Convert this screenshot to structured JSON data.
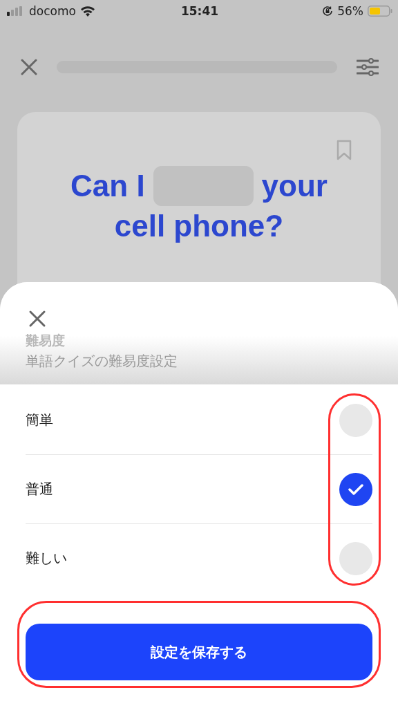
{
  "status_bar": {
    "carrier": "docomo",
    "time": "15:41",
    "battery": "56%"
  },
  "progress": {
    "level": 0
  },
  "question": {
    "start": "Can I",
    "end": "your",
    "second_line": "cell phone?"
  },
  "sheet": {
    "title": "難易度",
    "subtitle": "単語クイズの難易度設定",
    "options": [
      {
        "label": "簡単",
        "selected": false
      },
      {
        "label": "普通",
        "selected": true
      },
      {
        "label": "難しい",
        "selected": false
      }
    ],
    "save_button": "設定を保存する"
  }
}
